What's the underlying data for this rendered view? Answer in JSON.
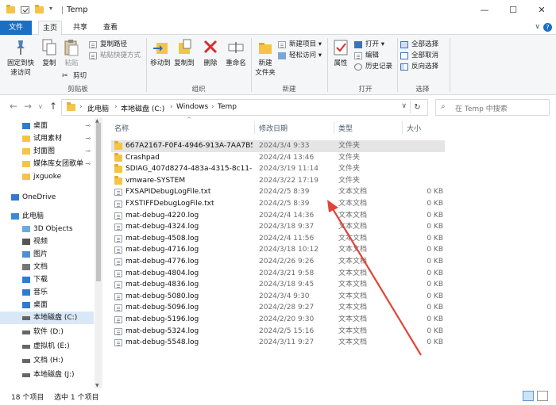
{
  "window": {
    "title": "Temp",
    "minimize": "—",
    "maximize": "☐",
    "close": "✕"
  },
  "ribbon_tabs": {
    "file": "文件",
    "home": "主页",
    "share": "共享",
    "view": "查看",
    "collapse": "∨",
    "help": "?"
  },
  "ribbon": {
    "clipboard": {
      "label": "剪贴板",
      "pin": "固定到快\n速访问",
      "copy": "复制",
      "paste": "粘贴",
      "copy_path": "复制路径",
      "paste_shortcut": "粘贴快捷方式",
      "cut": "剪切"
    },
    "organize": {
      "label": "组织",
      "move_to": "移动到",
      "copy_to": "复制到",
      "delete": "删除",
      "rename": "重命名"
    },
    "new": {
      "label": "新建",
      "new_folder": "新建\n文件夹",
      "new_item": "新建项目 ▾",
      "easy_access": "轻松访问 ▾"
    },
    "open": {
      "label": "打开",
      "properties": "属性",
      "open": "打开 ▾",
      "edit": "编辑",
      "history": "历史记录"
    },
    "select": {
      "label": "选择",
      "select_all": "全部选择",
      "select_none": "全部取消",
      "invert": "反向选择"
    }
  },
  "address": {
    "back": "←",
    "forward": "→",
    "recent": "∨",
    "up": "↑",
    "crumbs": [
      "此电脑",
      "本地磁盘 (C:)",
      "Windows",
      "Temp"
    ],
    "crumb_sep": "›",
    "dropdown": "∨",
    "refresh": "↻",
    "search_placeholder": "在 Temp 中搜索",
    "search_icon": "search-icon"
  },
  "sidebar": {
    "items": [
      {
        "label": "桌面",
        "icon": "desktop-icon",
        "pinned": true
      },
      {
        "label": "试用素材",
        "icon": "folder-icon",
        "pinned": true
      },
      {
        "label": "封面图",
        "icon": "folder-icon",
        "pinned": true
      },
      {
        "label": "媒体库女团歌单",
        "icon": "folder-icon",
        "pinned": true
      },
      {
        "label": "jxguoke",
        "icon": "folder-icon",
        "pinned": false
      },
      {
        "label": "OneDrive",
        "icon": "cloud-icon",
        "pinned": false
      },
      {
        "label": "此电脑",
        "icon": "computer-icon",
        "pinned": false
      },
      {
        "label": "3D Objects",
        "icon": "3d-objects-icon",
        "pinned": false
      },
      {
        "label": "视频",
        "icon": "video-icon",
        "pinned": false
      },
      {
        "label": "图片",
        "icon": "pictures-icon",
        "pinned": false
      },
      {
        "label": "文档",
        "icon": "documents-icon",
        "pinned": false
      },
      {
        "label": "下载",
        "icon": "download-icon",
        "pinned": false
      },
      {
        "label": "音乐",
        "icon": "music-icon",
        "pinned": false
      },
      {
        "label": "桌面",
        "icon": "desktop-icon",
        "pinned": false
      },
      {
        "label": "本地磁盘 (C:)",
        "icon": "drive-icon",
        "pinned": false
      },
      {
        "label": "软件 (D:)",
        "icon": "drive-icon",
        "pinned": false
      },
      {
        "label": "虚拟机 (E:)",
        "icon": "drive-icon",
        "pinned": false
      },
      {
        "label": "文档 (H:)",
        "icon": "drive-icon",
        "pinned": false
      },
      {
        "label": "本地磁盘 (J:)",
        "icon": "drive-icon",
        "pinned": false
      }
    ],
    "pin_glyph": "📌",
    "selected_label": "本地磁盘 (C:)"
  },
  "filelist": {
    "columns": {
      "name": "名称",
      "date": "修改日期",
      "type": "类型",
      "size": "大小"
    },
    "sort_caret": "^",
    "rows": [
      {
        "name": "667A2167-F0F4-4946-913A-7AA7B5B...",
        "date": "2024/3/4 9:33",
        "type": "文件夹",
        "size": "",
        "kind": "folder",
        "selected": true
      },
      {
        "name": "Crashpad",
        "date": "2024/2/4 13:46",
        "type": "文件夹",
        "size": "",
        "kind": "folder"
      },
      {
        "name": "SDIAG_407d8274-483a-4315-8c11-57...",
        "date": "2024/3/19 11:14",
        "type": "文件夹",
        "size": "",
        "kind": "folder"
      },
      {
        "name": "vmware-SYSTEM",
        "date": "2024/3/22 17:19",
        "type": "文件夹",
        "size": "",
        "kind": "folder"
      },
      {
        "name": "FXSAPIDebugLogFile.txt",
        "date": "2024/2/5 8:39",
        "type": "文本文档",
        "size": "0 KB",
        "kind": "doc"
      },
      {
        "name": "FXSTIFFDebugLogFile.txt",
        "date": "2024/2/5 8:39",
        "type": "文本文档",
        "size": "0 KB",
        "kind": "doc"
      },
      {
        "name": "mat-debug-4220.log",
        "date": "2024/2/4 14:36",
        "type": "文本文档",
        "size": "0 KB",
        "kind": "doc"
      },
      {
        "name": "mat-debug-4324.log",
        "date": "2024/3/18 9:37",
        "type": "文本文档",
        "size": "0 KB",
        "kind": "doc"
      },
      {
        "name": "mat-debug-4508.log",
        "date": "2024/2/4 11:56",
        "type": "文本文档",
        "size": "0 KB",
        "kind": "doc"
      },
      {
        "name": "mat-debug-4716.log",
        "date": "2024/3/18 10:12",
        "type": "文本文档",
        "size": "0 KB",
        "kind": "doc"
      },
      {
        "name": "mat-debug-4776.log",
        "date": "2024/2/26 9:26",
        "type": "文本文档",
        "size": "0 KB",
        "kind": "doc"
      },
      {
        "name": "mat-debug-4804.log",
        "date": "2024/3/21 9:58",
        "type": "文本文档",
        "size": "0 KB",
        "kind": "doc"
      },
      {
        "name": "mat-debug-4836.log",
        "date": "2024/3/18 9:45",
        "type": "文本文档",
        "size": "0 KB",
        "kind": "doc"
      },
      {
        "name": "mat-debug-5080.log",
        "date": "2024/3/4 9:30",
        "type": "文本文档",
        "size": "0 KB",
        "kind": "doc"
      },
      {
        "name": "mat-debug-5096.log",
        "date": "2024/2/28 9:27",
        "type": "文本文档",
        "size": "0 KB",
        "kind": "doc"
      },
      {
        "name": "mat-debug-5196.log",
        "date": "2024/2/20 9:30",
        "type": "文本文档",
        "size": "0 KB",
        "kind": "doc"
      },
      {
        "name": "mat-debug-5324.log",
        "date": "2024/2/5 15:16",
        "type": "文本文档",
        "size": "0 KB",
        "kind": "doc"
      },
      {
        "name": "mat-debug-5548.log",
        "date": "2024/3/11 9:27",
        "type": "文本文档",
        "size": "0 KB",
        "kind": "doc"
      }
    ]
  },
  "status": {
    "count": "18 个项目",
    "selected": "选中 1 个项目"
  },
  "colors": {
    "accent": "#1a6fc4",
    "folder": "#f4c446",
    "annotation_arrow": "#e0453a",
    "selected_row": "#e5e5e5"
  }
}
